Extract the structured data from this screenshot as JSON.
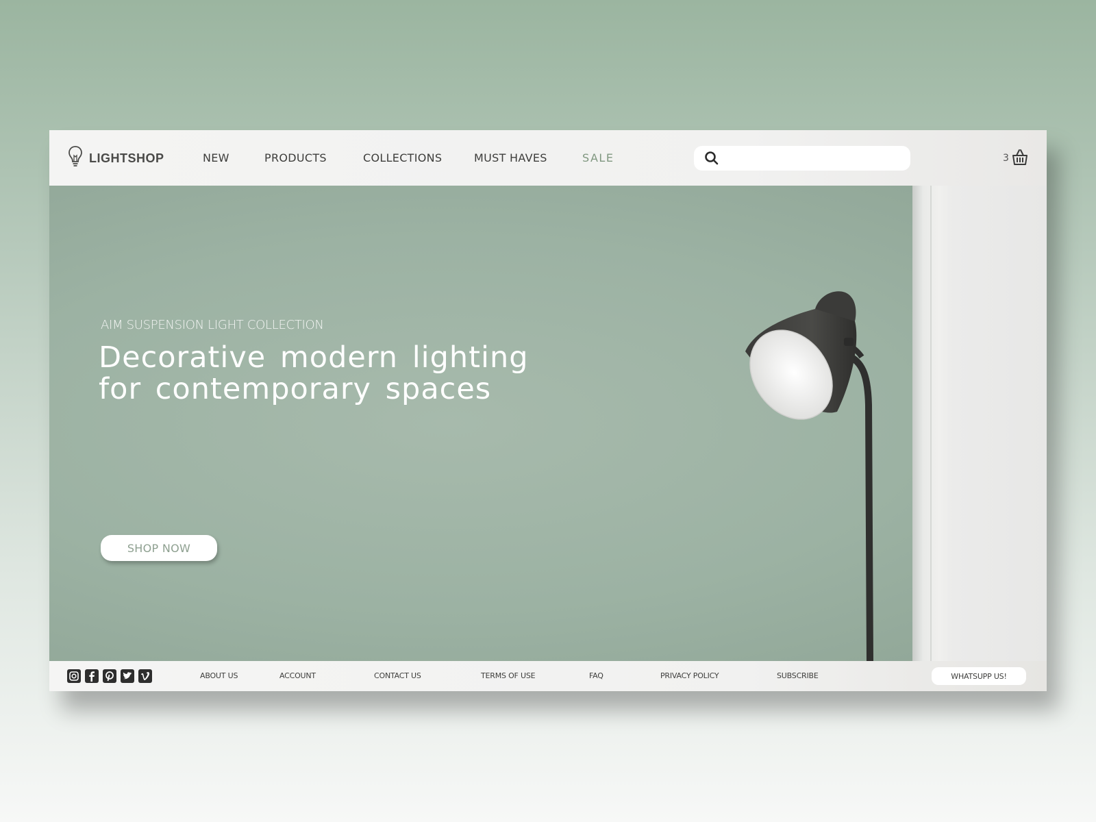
{
  "header": {
    "brand": "LIGHTSHOP",
    "nav": [
      {
        "label": "NEW"
      },
      {
        "label": "PRODUCTS"
      },
      {
        "label": "COLLECTIONS"
      },
      {
        "label": "MUST HAVES"
      },
      {
        "label": "SALE"
      }
    ],
    "search": {
      "value": "",
      "placeholder": ""
    },
    "cart": {
      "count": "3",
      "icon": "basket-icon"
    },
    "logo_icon": "lightbulb-icon"
  },
  "hero": {
    "eyebrow": "AIM SUSPENSION LIGHT COLLECTION",
    "title_line1": "Decorative modern lighting",
    "title_line2": "for contemporary spaces",
    "cta": "SHOP NOW",
    "image": "floor-lamp-image"
  },
  "footer": {
    "social": [
      {
        "icon": "instagram-icon"
      },
      {
        "icon": "facebook-icon"
      },
      {
        "icon": "pinterest-icon"
      },
      {
        "icon": "twitter-icon"
      },
      {
        "icon": "vimeo-icon"
      }
    ],
    "links": [
      {
        "label": "ABOUT US"
      },
      {
        "label": "ACCOUNT"
      },
      {
        "label": "CONTACT US"
      },
      {
        "label": "TERMS OF USE"
      },
      {
        "label": "FAQ"
      },
      {
        "label": "PRIVACY POLICY"
      },
      {
        "label": "SUBSCRIBE"
      }
    ],
    "whatsapp": "WHATSUPP US!"
  },
  "colors": {
    "page_bg": "#9bb5a0",
    "hero_wall": "#9fb5a5",
    "sale_accent": "#7f977f",
    "text_dark": "#3d3d3b",
    "cta_text": "#8ea090"
  }
}
